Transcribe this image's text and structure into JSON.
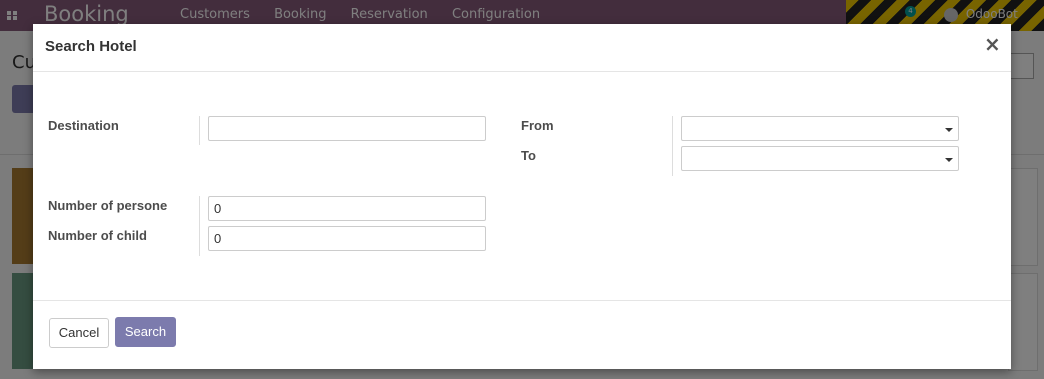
{
  "navbar": {
    "brand": "Booking",
    "menu": [
      "Customers",
      "Booking",
      "Reservation",
      "Configuration"
    ],
    "chat_count": "4",
    "user": "OdooBot"
  },
  "background": {
    "title": "Cu"
  },
  "dialog": {
    "title": "Search Hotel",
    "close": "×",
    "destination_label": "Destination",
    "destination_value": "",
    "from_label": "From",
    "to_label": "To",
    "persons_label": "Number of persone",
    "persons_value": "0",
    "children_label": "Number of child",
    "children_value": "0",
    "cancel_label": "Cancel",
    "search_label": "Search"
  },
  "colors": {
    "navbar": "#875a7b",
    "primary": "#7c7bad"
  },
  "icons": [
    "apps-icon",
    "chat-icon",
    "close-icon",
    "caret-down-icon",
    "search-icon"
  ]
}
